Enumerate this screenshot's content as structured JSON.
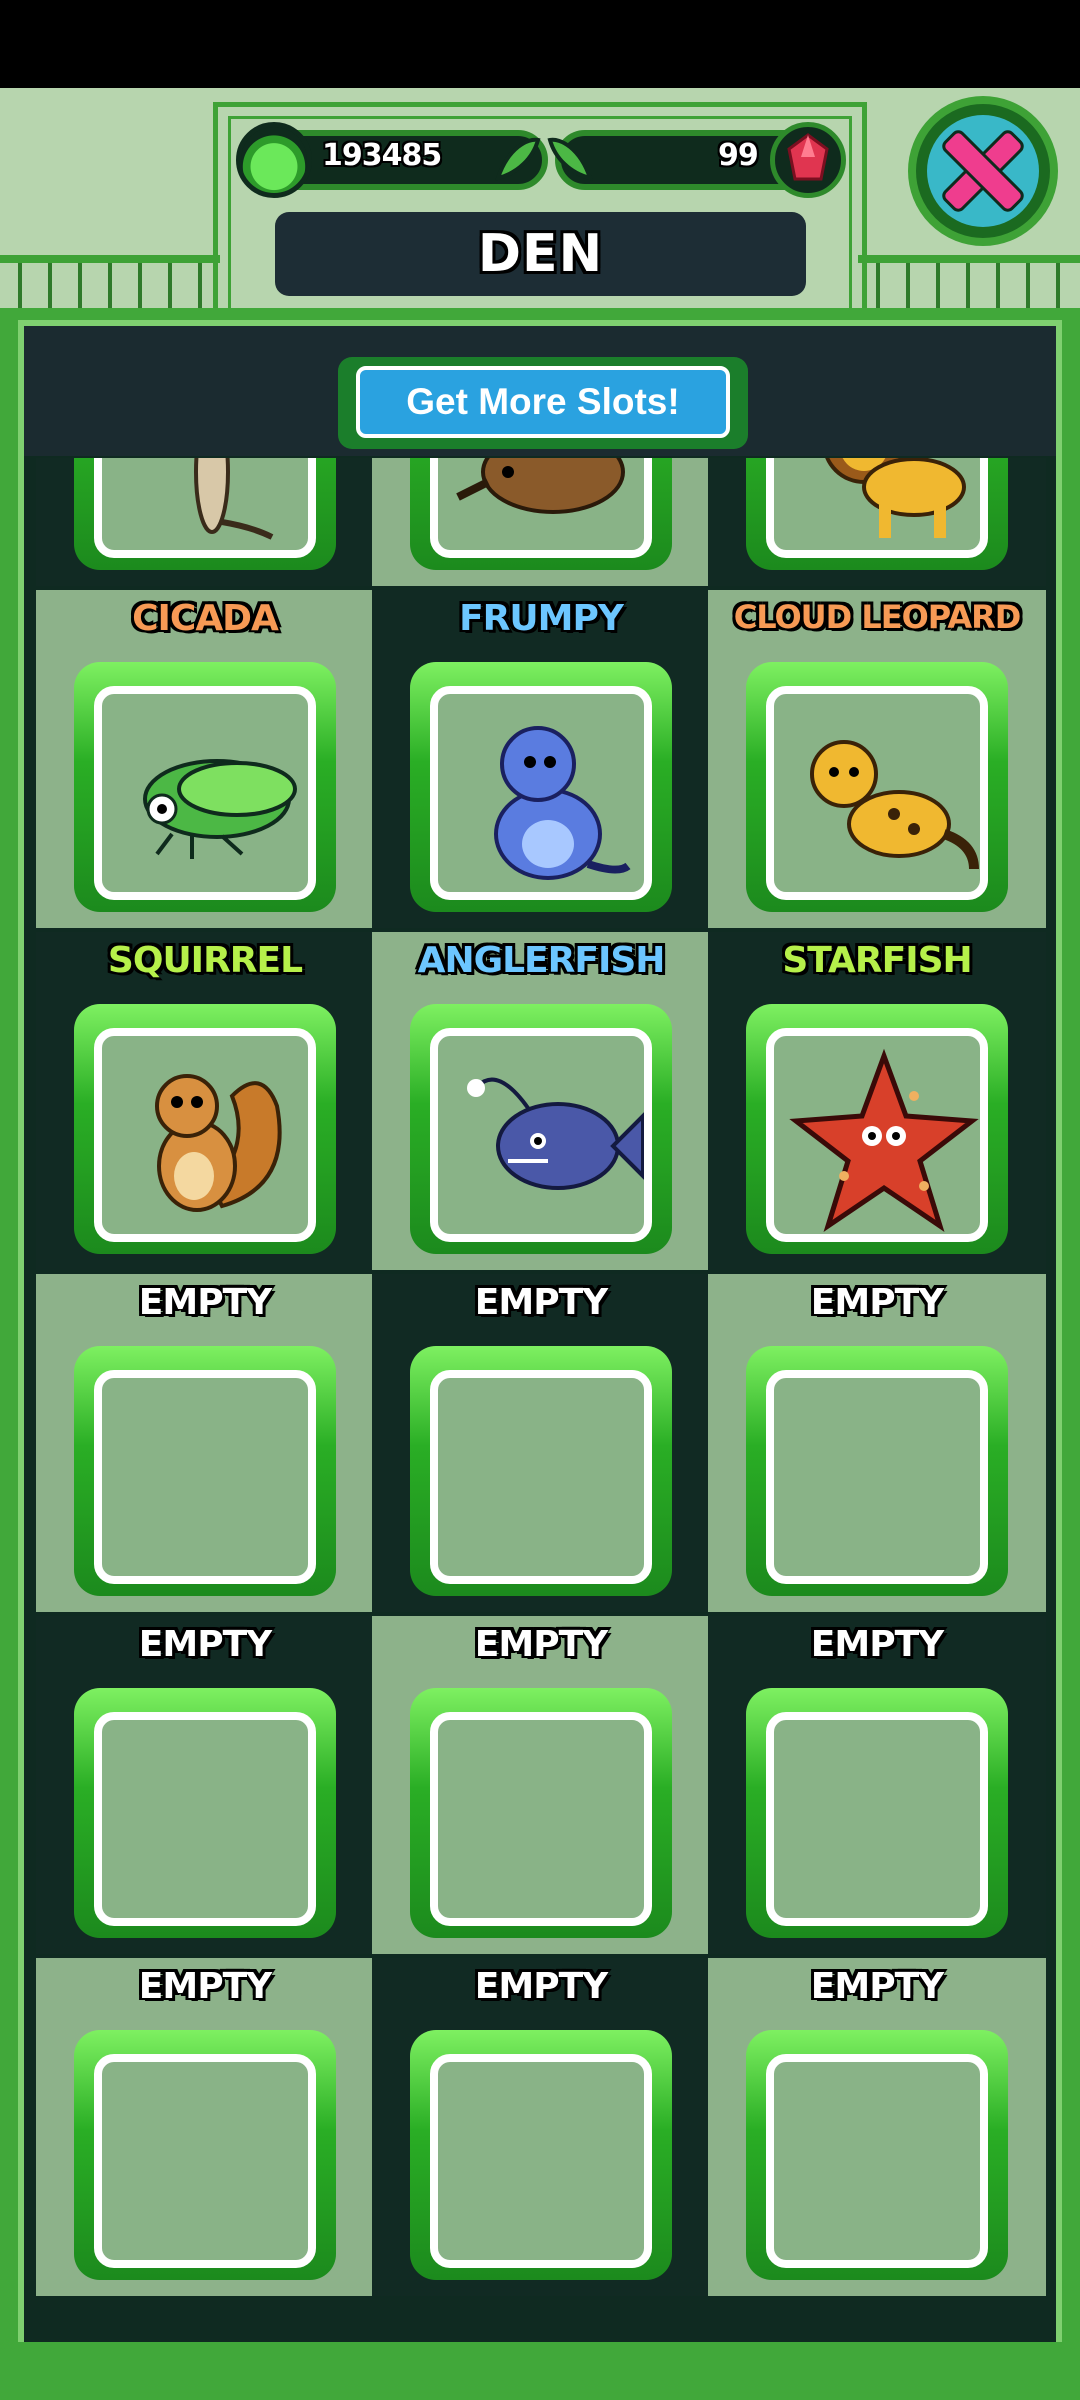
{
  "header": {
    "gel_count": "193485",
    "gem_count": "99",
    "title": "DEN"
  },
  "slots_button_label": "Get More Slots!",
  "colors": {
    "orange_label": "#f79a55",
    "blue_label": "#6cc6ff",
    "green_label": "#b6f04a",
    "white_label": "#ffffff"
  },
  "creatures": [
    {
      "name": "",
      "icon": "meerkat-icon"
    },
    {
      "name": "",
      "icon": "echidna-icon"
    },
    {
      "name": "",
      "icon": "lion-icon"
    },
    {
      "name": "CICADA",
      "icon": "cicada-icon",
      "color": "#f79a55"
    },
    {
      "name": "FRUMPY",
      "icon": "frumpy-icon",
      "color": "#6cc6ff"
    },
    {
      "name": "CLOUD LEOPARD",
      "icon": "cloud-leopard-icon",
      "color": "#f79a55"
    },
    {
      "name": "SQUIRREL",
      "icon": "squirrel-icon",
      "color": "#b6f04a"
    },
    {
      "name": "ANGLERFISH",
      "icon": "anglerfish-icon",
      "color": "#6cc6ff"
    },
    {
      "name": "STARFISH",
      "icon": "starfish-icon",
      "color": "#b6f04a"
    },
    {
      "name": "EMPTY",
      "icon": "",
      "color": "#ffffff"
    },
    {
      "name": "EMPTY",
      "icon": "",
      "color": "#ffffff"
    },
    {
      "name": "EMPTY",
      "icon": "",
      "color": "#ffffff"
    },
    {
      "name": "EMPTY",
      "icon": "",
      "color": "#ffffff"
    },
    {
      "name": "EMPTY",
      "icon": "",
      "color": "#ffffff"
    },
    {
      "name": "EMPTY",
      "icon": "",
      "color": "#ffffff"
    },
    {
      "name": "EMPTY",
      "icon": "",
      "color": "#ffffff"
    },
    {
      "name": "EMPTY",
      "icon": "",
      "color": "#ffffff"
    },
    {
      "name": "EMPTY",
      "icon": "",
      "color": "#ffffff"
    }
  ]
}
